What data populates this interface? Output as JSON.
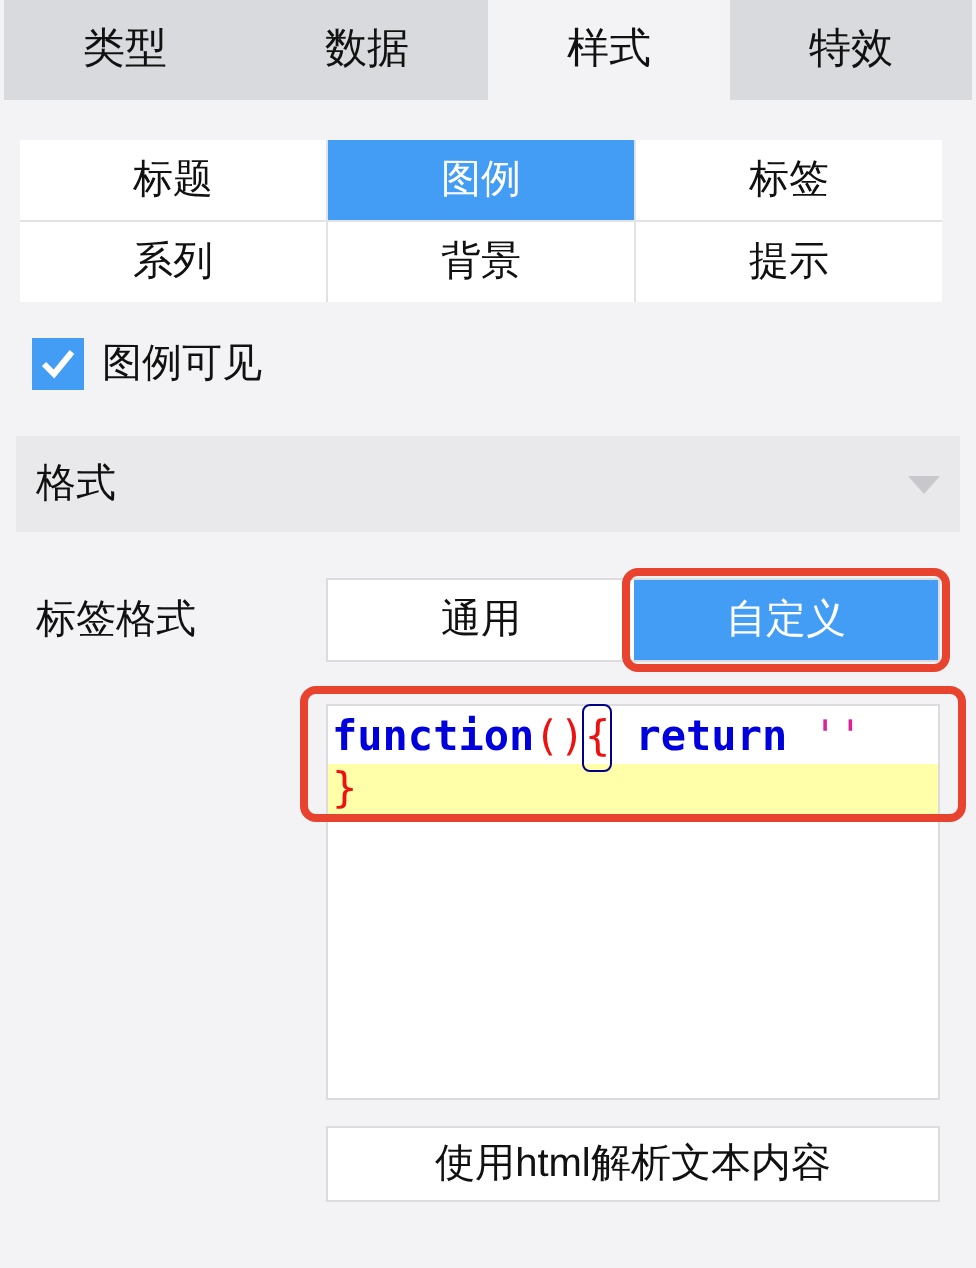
{
  "tabs": [
    {
      "label": "类型",
      "selected": false
    },
    {
      "label": "数据",
      "selected": false
    },
    {
      "label": "样式",
      "selected": true
    },
    {
      "label": "特效",
      "selected": false
    }
  ],
  "sub_tabs": [
    {
      "label": "标题",
      "selected": false
    },
    {
      "label": "图例",
      "selected": true
    },
    {
      "label": "标签",
      "selected": false
    },
    {
      "label": "系列",
      "selected": false
    },
    {
      "label": "背景",
      "selected": false
    },
    {
      "label": "提示",
      "selected": false
    }
  ],
  "legend_visible": {
    "label": "图例可见",
    "checked": true
  },
  "section": {
    "title": "格式",
    "expanded": true
  },
  "label_format": {
    "label": "标签格式",
    "options": [
      {
        "label": "通用",
        "selected": false,
        "highlighted": false
      },
      {
        "label": "自定义",
        "selected": true,
        "highlighted": true
      }
    ]
  },
  "code_editor": {
    "highlighted": true,
    "lines": [
      {
        "current": false,
        "tokens": [
          {
            "text": "function",
            "kind": "keyword"
          },
          {
            "text": "()",
            "kind": "bracket"
          },
          {
            "text": "{",
            "kind": "bracket",
            "matched": true
          },
          {
            "text": " return",
            "kind": "keyword"
          },
          {
            "text": " ''",
            "kind": "string"
          }
        ]
      },
      {
        "current": true,
        "tokens": [
          {
            "text": "}",
            "kind": "bracket"
          }
        ]
      }
    ]
  },
  "html_button": {
    "label": "使用html解析文本内容"
  }
}
